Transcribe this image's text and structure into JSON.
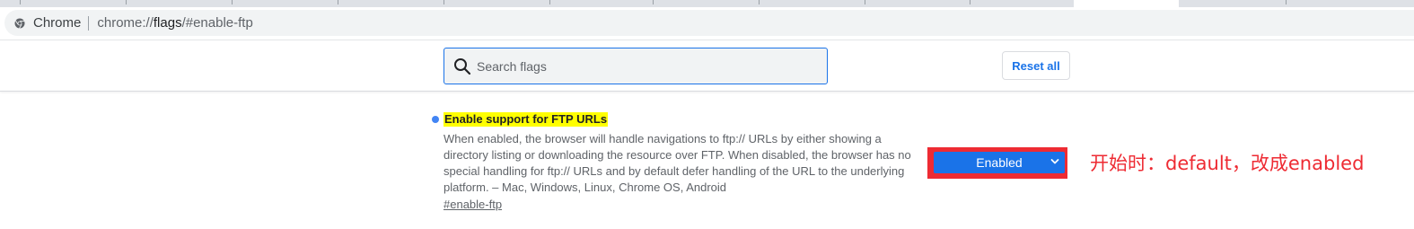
{
  "browser": {
    "chip_label": "Chrome",
    "url_prefix": "chrome://",
    "url_host": "flags",
    "url_path": "/#enable-ftp"
  },
  "search": {
    "placeholder": "Search flags",
    "value": ""
  },
  "header": {
    "reset_label": "Reset all"
  },
  "experiment": {
    "title": "Enable support for FTP URLs",
    "description": "When enabled, the browser will handle navigations to ftp:// URLs by either showing a directory listing or downloading the resource over FTP. When disabled, the browser has no special handling for ftp:// URLs and by default defer handling of the URL to the underlying platform. – Mac, Windows, Linux, Chrome OS, Android",
    "link": "#enable-ftp",
    "selected_value": "Enabled"
  },
  "annotation": {
    "text": "开始时：default，改成enabled"
  },
  "colors": {
    "accent": "#1a73e8",
    "highlight_text_bg": "#ffff00",
    "annotation_red": "#ee2b33",
    "modified_dot": "#4285f4"
  }
}
